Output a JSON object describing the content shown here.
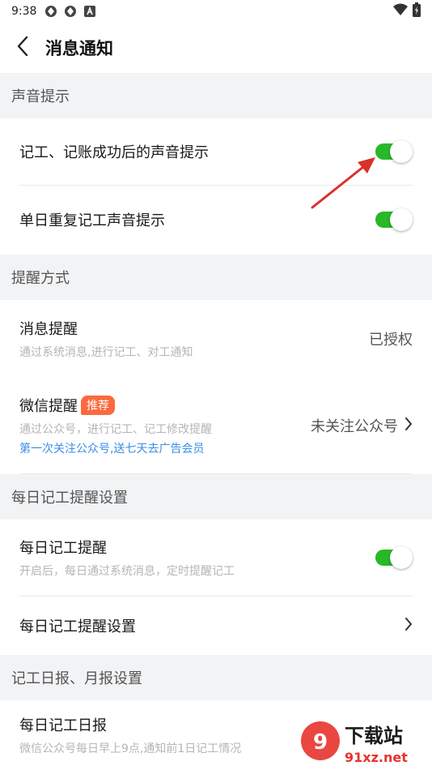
{
  "status_bar": {
    "time": "9:38"
  },
  "header": {
    "title": "消息通知"
  },
  "sections": {
    "sound": "声音提示",
    "reminder_method": "提醒方式",
    "daily_reminder": "每日记工提醒设置",
    "report": "记工日报、月报设置"
  },
  "rows": {
    "sound_success": {
      "label": "记工、记账成功后的声音提示",
      "on": true
    },
    "sound_repeat": {
      "label": "单日重复记工声音提示",
      "on": true
    },
    "msg_reminder": {
      "label": "消息提醒",
      "sub": "通过系统消息,进行记工、对工通知",
      "value": "已授权"
    },
    "wechat_reminder": {
      "label": "微信提醒",
      "badge": "推荐",
      "sub": "通过公众号，进行记工、记工修改提醒",
      "promo": "第一次关注公众号,送七天去广告会员",
      "value": "未关注公众号"
    },
    "daily_reminder": {
      "label": "每日记工提醒",
      "sub": "开启后，每日通过系统消息，定时提醒记工",
      "on": true
    },
    "daily_reminder_settings": {
      "label": "每日记工提醒设置"
    },
    "daily_report": {
      "label": "每日记工日报",
      "sub": "微信公众号每日早上9点,通知前1日记工情况"
    }
  },
  "watermark": {
    "text": "下载站",
    "url_text": "91xz.net"
  },
  "colors": {
    "toggle_on": "#28b828",
    "badge": "#fb6a3e",
    "promo": "#3a8ee6",
    "section_bg": "#f2f3f5",
    "annotation_arrow": "#d9302b"
  }
}
